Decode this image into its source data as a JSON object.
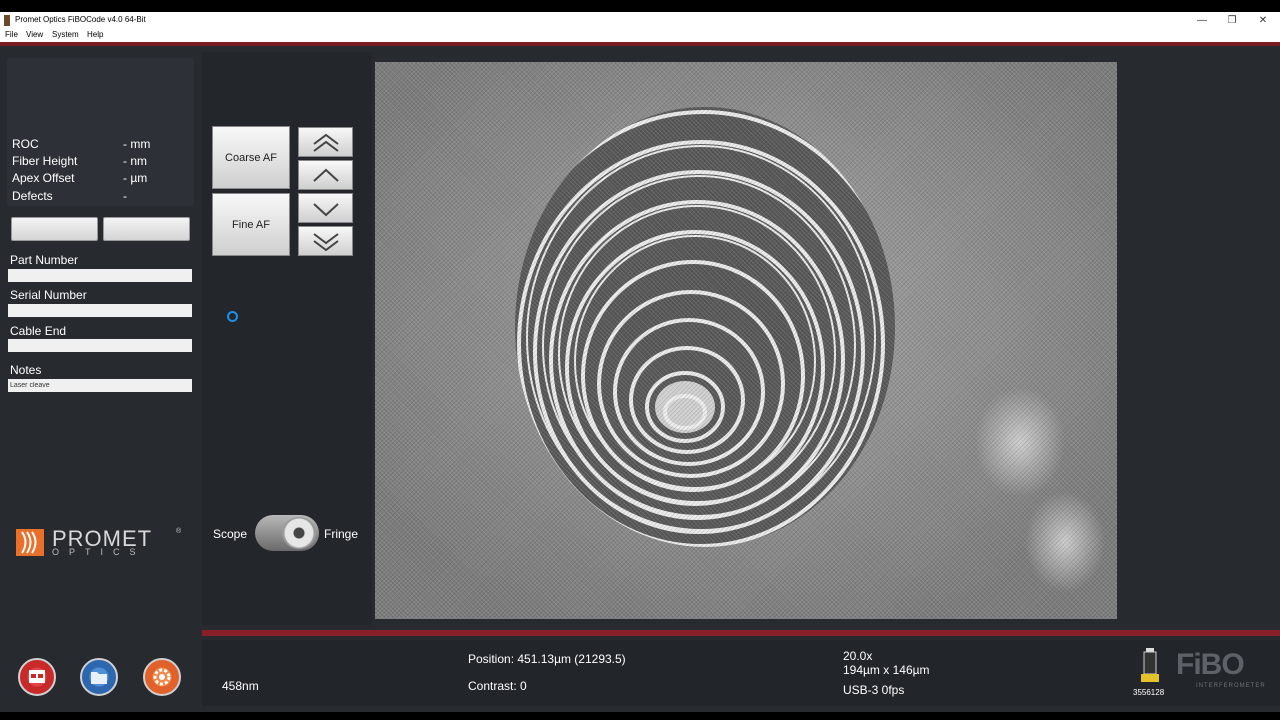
{
  "window": {
    "title": "Promet Optics FiBOCode v4.0 64-Bit",
    "controls": [
      "—",
      "❐",
      "✕"
    ]
  },
  "menu": [
    "File",
    "View",
    "System",
    "Help"
  ],
  "metrics": [
    {
      "label": "ROC",
      "value": "- mm"
    },
    {
      "label": "Fiber Height",
      "value": "- nm"
    },
    {
      "label": "Apex Offset",
      "value": "- µm"
    },
    {
      "label": "Defects",
      "value": "-"
    }
  ],
  "fields": {
    "part_number": {
      "label": "Part Number",
      "value": ""
    },
    "serial_number": {
      "label": "Serial Number",
      "value": ""
    },
    "cable_end": {
      "label": "Cable End",
      "value": ""
    },
    "notes": {
      "label": "Notes",
      "value": "Laser cleave"
    }
  },
  "logo": {
    "name": "PROMET",
    "sub": "OPTICS",
    "reg": "®"
  },
  "autofocus": {
    "coarse": "Coarse AF",
    "fine": "Fine AF"
  },
  "toggle": {
    "left": "Scope",
    "right": "Fringe"
  },
  "status": {
    "wavelength": "458nm",
    "position": "Position: 451.13µm (21293.5)",
    "contrast": "Contrast: 0",
    "magnification": "20.0x",
    "field_of_view": "194µm x 146µm",
    "camera": "USB-3  0fps",
    "device_id": "3556128"
  },
  "brand": {
    "name": "FiBO",
    "sub": "INTERFEROMETER"
  },
  "icons": {
    "fast_up": "double-chevron-up-icon",
    "up": "chevron-up-icon",
    "down": "chevron-down-icon",
    "fast_down": "double-chevron-down-icon"
  },
  "colors": {
    "accent": "#7a1c24",
    "panel": "#272b30",
    "cursor": "#1f8fe8"
  }
}
